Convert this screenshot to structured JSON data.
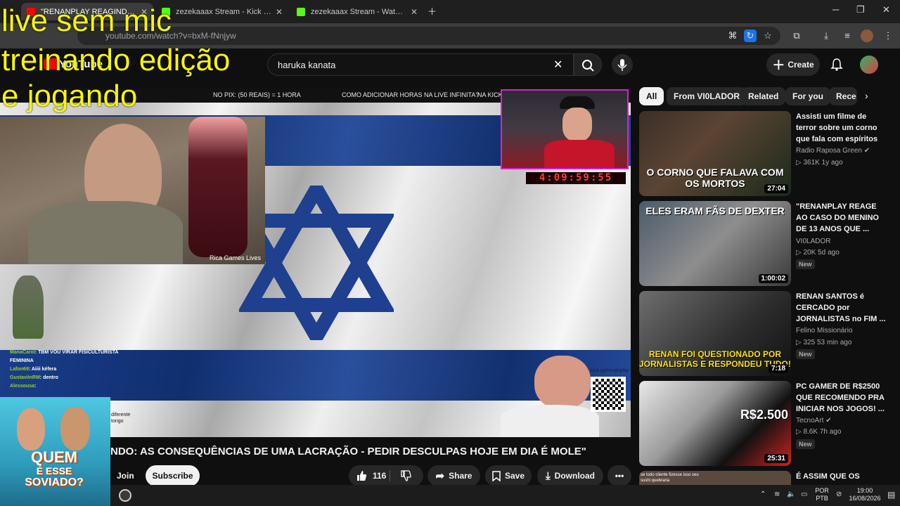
{
  "browser": {
    "tabs": [
      {
        "title": "\"RENANPLAY REAGINDO: AS C",
        "favicon_color": "#ff0000"
      },
      {
        "title": "zezekaaax Stream - Kick Dashbo",
        "favicon_color": "#53fc18"
      },
      {
        "title": "zezekaaax Stream - Watch Live",
        "favicon_color": "#53fc18"
      }
    ],
    "url": "youtube.com/watch?v=bxM-fNnjyw"
  },
  "overlay_text": [
    "live sem mic",
    "treinando edição",
    "e jogando"
  ],
  "youtube": {
    "logo": "YouTube",
    "search_query": "haruka kanata",
    "create_label": "Create"
  },
  "video": {
    "ticker": {
      "items": [
        "NO PIX: (50 REAIS) = 1 HORA",
        "COMO ADICIONAR HORAS NA LIVE INFINITA?",
        "NA KICK:"
      ]
    },
    "timer": "4:09:59:55",
    "cam_label": "Rica Games Lives",
    "chat": [
      {
        "user": "ManaCarol",
        "text": "TBM VOU VIRAR FISICULTURISTA FEMININA"
      },
      {
        "user": "Lafon69",
        "text": "Aiiii kéfera"
      },
      {
        "user": "GustaviinRM",
        "text": "dentro"
      },
      {
        "user": "Alessousa",
        "text": ":"
      }
    ],
    "kick_handle": "kick.gg/renanplay",
    "side_text": "diferente tongo"
  },
  "video_info": {
    "title": "NDO: AS CONSEQUÊNCIAS DE UMA LACRAÇÃO - PEDIR DESCULPAS HOJE EM DIA É MOLE\"",
    "join_label": "Join",
    "subscribe_label": "Subscribe",
    "likes": "116",
    "share_label": "Share",
    "save_label": "Save",
    "download_label": "Download"
  },
  "quem_overlay": [
    "QUEM",
    "É ESSE",
    "SOVIADO?"
  ],
  "sidebar": {
    "chips": [
      "All",
      "From VI0LADOR",
      "Related",
      "For you",
      "Rece"
    ],
    "videos": [
      {
        "title": "Assisti um filme de terror sobre um corno que fala com espíritos",
        "channel": "Radio Raposa Green",
        "views": "361K",
        "age": "1y ago",
        "duration": "27:04",
        "caption": "O CORNO QUE FALAVA COM OS MORTOS",
        "badge": ""
      },
      {
        "title": "\"RENANPLAY REAGE AO CASO DO MENINO DE 13 ANOS QUE ...",
        "channel": "VI0LADOR",
        "views": "20K",
        "age": "5d ago",
        "duration": "1:00:02",
        "caption": "ELES ERAM FÃS DE DEXTER",
        "badge": "New"
      },
      {
        "title": "RENAN SANTOS é CERCADO por JORNALISTAS no FIM ...",
        "channel": "Felino Missionário",
        "views": "325",
        "age": "53 min ago",
        "duration": "7:18",
        "caption": "RENAN FOI QUESTIONADO POR JORNALISTAS E RESPONDEU TUDO!",
        "badge": "New"
      },
      {
        "title": "PC GAMER DE R$2500 QUE RECOMENDO PRA INICIAR NOS JOGOS! ...",
        "channel": "TecnoArt",
        "views": "8.6K",
        "age": "7h ago",
        "duration": "25:31",
        "caption": "R$2.500",
        "badge": "New"
      },
      {
        "title": "É ASSIM QUE OS",
        "channel": "",
        "views": "",
        "age": "",
        "duration": "",
        "caption": "se todo cliente fizesse isso seu sushi quebraria",
        "badge": ""
      }
    ]
  },
  "taskbar": {
    "lang": "POR",
    "layout": "PTB",
    "time": "19:00",
    "date": "16/08/2026"
  }
}
